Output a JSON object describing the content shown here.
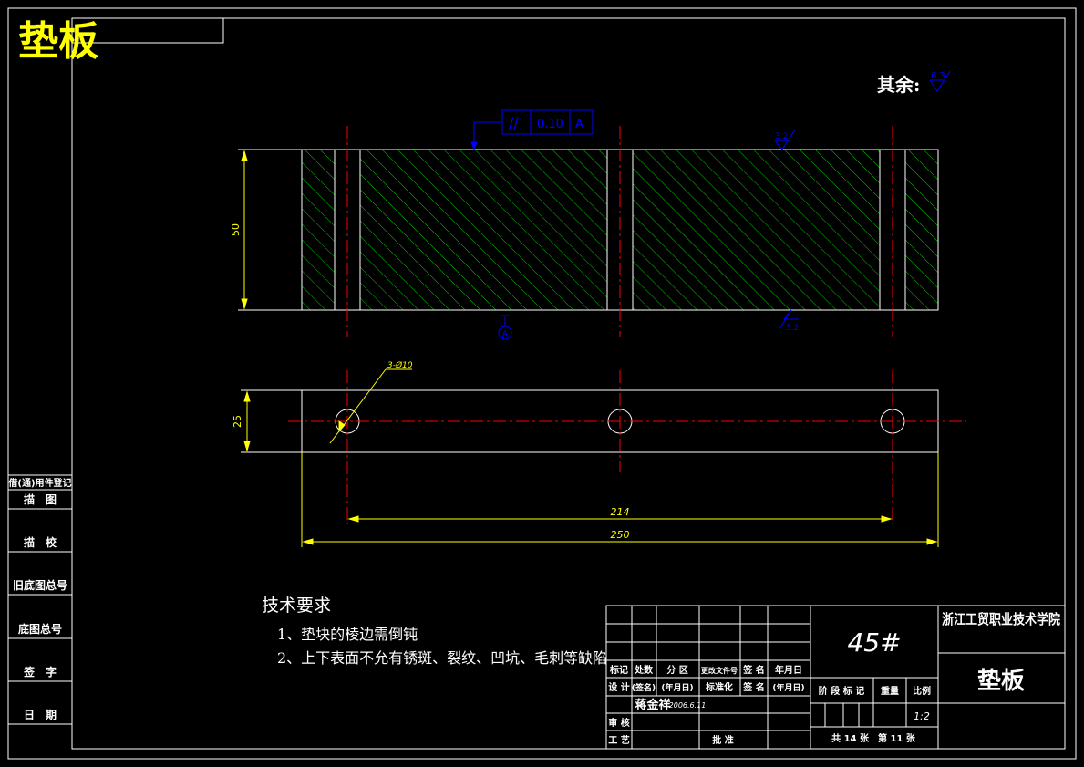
{
  "title": "垫板",
  "roughness": {
    "other_label": "其余:",
    "other_value": "6.3",
    "top_value": "3.2",
    "bottom_value": "3.2"
  },
  "tolerance": {
    "symbol": "//",
    "value": "0.10",
    "datum": "A"
  },
  "datum_label": "A",
  "dimensions": {
    "height_front": "50",
    "height_top": "25",
    "holes": "3-Ø10",
    "pitch": "214",
    "length": "250"
  },
  "tech_requirements": {
    "heading": "技术要求",
    "items": [
      "1、垫块的棱边需倒钝",
      "2、上下表面不允有锈斑、裂纹、凹坑、毛刺等缺陷"
    ]
  },
  "side_panel": {
    "labels": [
      "借(通)用件登记",
      "描　图",
      "描　校",
      "旧底图总号",
      "底图总号",
      "签　字",
      "日　期"
    ]
  },
  "title_block": {
    "header_row": [
      "标记",
      "处数",
      "分 区",
      "更改文件号",
      "签 名",
      "年月日"
    ],
    "design_row": [
      "设 计",
      "(签名)",
      "(年月日)",
      "标准化",
      "签 名",
      "(年月日)"
    ],
    "designer_name": "蒋金祥",
    "design_date": "2006.6.11",
    "review": "审 核",
    "process": "工 艺",
    "approve": "批 准",
    "material": "45#",
    "school": "浙江工贸职业技术学院",
    "part_name": "垫板",
    "stage_label": "阶 段 标 记",
    "weight_label": "重量",
    "scale_label": "比例",
    "scale_value": "1:2",
    "sheets": "共 14 张　第 11 张"
  }
}
